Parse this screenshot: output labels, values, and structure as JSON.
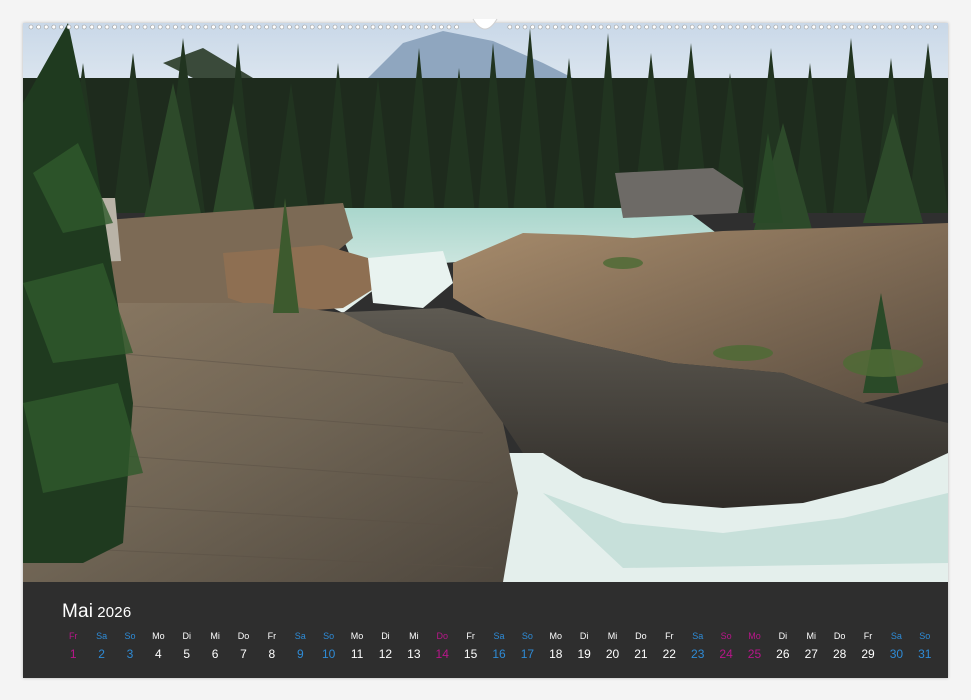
{
  "calendar": {
    "month": "Mai",
    "year": "2026",
    "colors": {
      "weekday": "#ffffff",
      "weekend": "#2e8bd6",
      "holiday": "#b8168a"
    },
    "days": [
      {
        "wd": "Fr",
        "num": "1",
        "kind": "holiday"
      },
      {
        "wd": "Sa",
        "num": "2",
        "kind": "weekend"
      },
      {
        "wd": "So",
        "num": "3",
        "kind": "weekend"
      },
      {
        "wd": "Mo",
        "num": "4",
        "kind": "weekday"
      },
      {
        "wd": "Di",
        "num": "5",
        "kind": "weekday"
      },
      {
        "wd": "Mi",
        "num": "6",
        "kind": "weekday"
      },
      {
        "wd": "Do",
        "num": "7",
        "kind": "weekday"
      },
      {
        "wd": "Fr",
        "num": "8",
        "kind": "weekday"
      },
      {
        "wd": "Sa",
        "num": "9",
        "kind": "weekend"
      },
      {
        "wd": "So",
        "num": "10",
        "kind": "weekend"
      },
      {
        "wd": "Mo",
        "num": "11",
        "kind": "weekday"
      },
      {
        "wd": "Di",
        "num": "12",
        "kind": "weekday"
      },
      {
        "wd": "Mi",
        "num": "13",
        "kind": "weekday"
      },
      {
        "wd": "Do",
        "num": "14",
        "kind": "holiday"
      },
      {
        "wd": "Fr",
        "num": "15",
        "kind": "weekday"
      },
      {
        "wd": "Sa",
        "num": "16",
        "kind": "weekend"
      },
      {
        "wd": "So",
        "num": "17",
        "kind": "weekend"
      },
      {
        "wd": "Mo",
        "num": "18",
        "kind": "weekday"
      },
      {
        "wd": "Di",
        "num": "19",
        "kind": "weekday"
      },
      {
        "wd": "Mi",
        "num": "20",
        "kind": "weekday"
      },
      {
        "wd": "Do",
        "num": "21",
        "kind": "weekday"
      },
      {
        "wd": "Fr",
        "num": "22",
        "kind": "weekday"
      },
      {
        "wd": "Sa",
        "num": "23",
        "kind": "weekend"
      },
      {
        "wd": "So",
        "num": "24",
        "kind": "holiday"
      },
      {
        "wd": "Mo",
        "num": "25",
        "kind": "holiday"
      },
      {
        "wd": "Di",
        "num": "26",
        "kind": "weekday"
      },
      {
        "wd": "Mi",
        "num": "27",
        "kind": "weekday"
      },
      {
        "wd": "Do",
        "num": "28",
        "kind": "weekday"
      },
      {
        "wd": "Fr",
        "num": "29",
        "kind": "weekday"
      },
      {
        "wd": "Sa",
        "num": "30",
        "kind": "weekend"
      },
      {
        "wd": "So",
        "num": "31",
        "kind": "weekend"
      }
    ]
  }
}
